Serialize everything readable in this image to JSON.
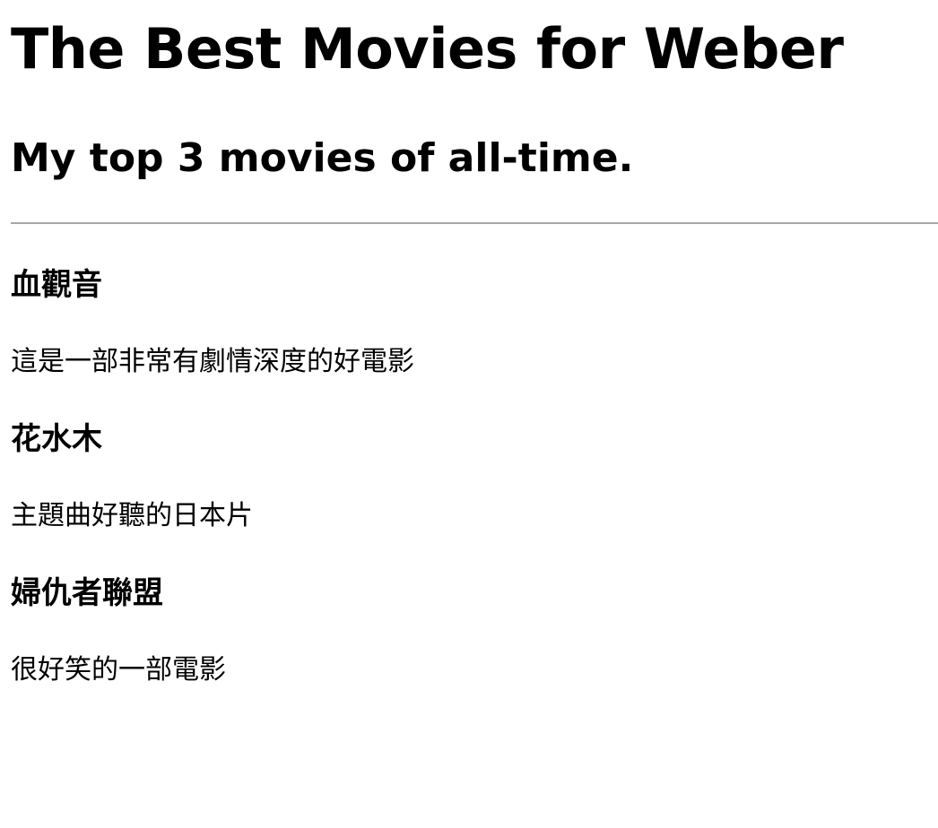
{
  "header": {
    "title": "The Best Movies for Weber",
    "subtitle": "My top 3 movies of all-time."
  },
  "movies": [
    {
      "title": "血觀音",
      "description": "這是一部非常有劇情深度的好電影"
    },
    {
      "title": "花水木",
      "description": "主題曲好聽的日本片"
    },
    {
      "title": "婦仇者聯盟",
      "description": "很好笑的一部電影"
    }
  ],
  "colors": {
    "text": "#000000",
    "divider": "#a8a8a8",
    "background": "#ffffff"
  }
}
